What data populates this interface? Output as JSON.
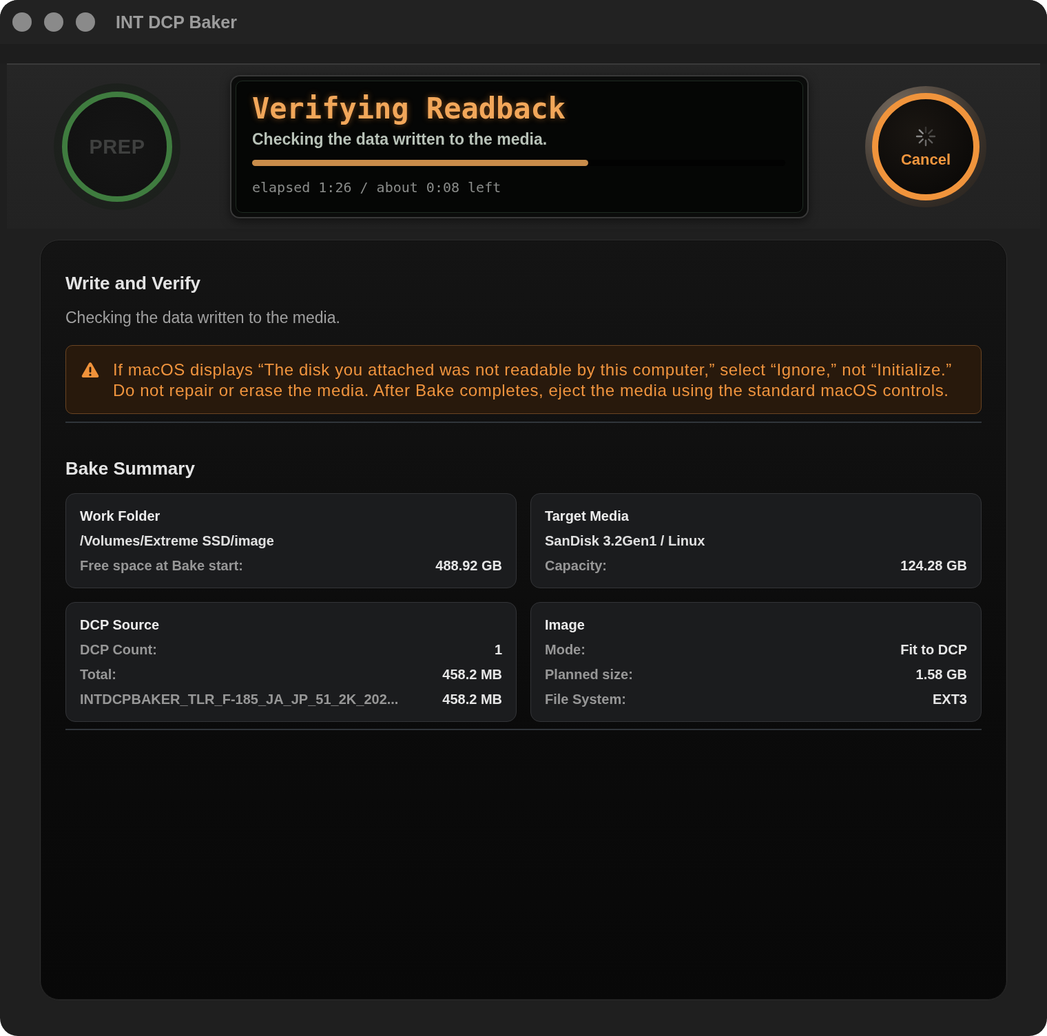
{
  "window": {
    "title": "INT DCP Baker"
  },
  "header": {
    "prep_button": {
      "label": "PREP",
      "disabled": true
    },
    "status": {
      "title": "Verifying Readback",
      "subtitle": "Checking the data written to the media.",
      "progress": {
        "level": 0.63
      },
      "timing": "elapsed 1:26 / about 0:08 left"
    },
    "cancel_button": {
      "label": "Cancel",
      "busy": true
    }
  },
  "section": {
    "title": "Write and Verify",
    "description": "Checking the data written to the media.",
    "warning": "If macOS displays “The disk you attached was not readable by this computer,” select “Ignore,” not “Initialize.” Do not repair or erase the media. After Bake completes, eject the media using the standard macOS controls."
  },
  "summary": {
    "title": "Bake Summary",
    "cards": [
      {
        "title": "Work Folder",
        "detail": "/Volumes/Extreme SSD/image",
        "rows": [
          {
            "label": "Free space at Bake start:",
            "value": "488.92 GB"
          }
        ]
      },
      {
        "title": "Target Media",
        "detail": "SanDisk 3.2Gen1 / Linux",
        "rows": [
          {
            "label": "Capacity:",
            "value": "124.28 GB"
          }
        ]
      },
      {
        "title": "DCP Source",
        "rows": [
          {
            "label": "DCP Count:",
            "value": "1"
          },
          {
            "label": "Total:",
            "value": "458.2 MB"
          },
          {
            "label": "INTDCPBAKER_TLR_F-185_JA_JP_51_2K_202...",
            "value": "458.2 MB"
          }
        ]
      },
      {
        "title": "Image",
        "rows": [
          {
            "label": "Mode:",
            "value": "Fit to DCP"
          },
          {
            "label": "Planned size:",
            "value": "1.58 GB"
          },
          {
            "label": "File System:",
            "value": "EXT3"
          }
        ]
      }
    ]
  }
}
